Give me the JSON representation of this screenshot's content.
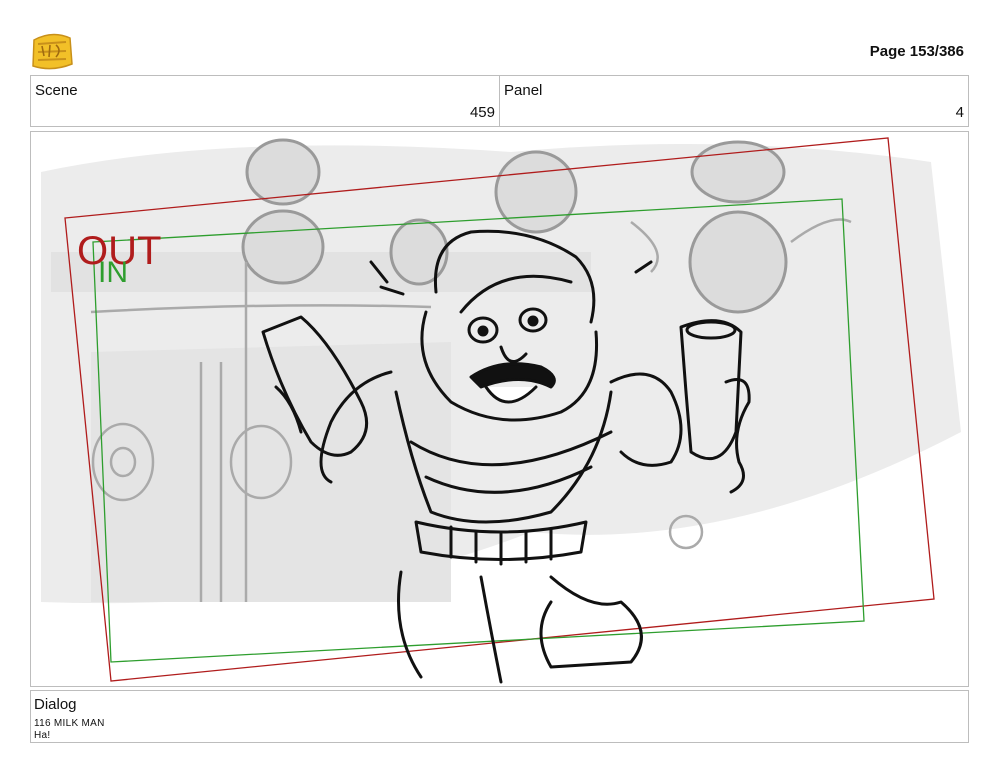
{
  "header": {
    "logo_name": "young-jedi-adventures-logo",
    "logo_colors": {
      "fill": "#f2c028",
      "outline": "#c8901a"
    },
    "page": "Page 153/386"
  },
  "info": {
    "scene_label": "Scene",
    "scene_value": "459",
    "panel_label": "Panel",
    "panel_value": "4"
  },
  "frame": {
    "out_label": "OUT",
    "in_label": "IN",
    "out_color": "#b01c1c",
    "in_color": "#2e9e2e"
  },
  "dialog": {
    "label": "Dialog",
    "lines": [
      "116 MILK MAN",
      "Ha!"
    ]
  }
}
